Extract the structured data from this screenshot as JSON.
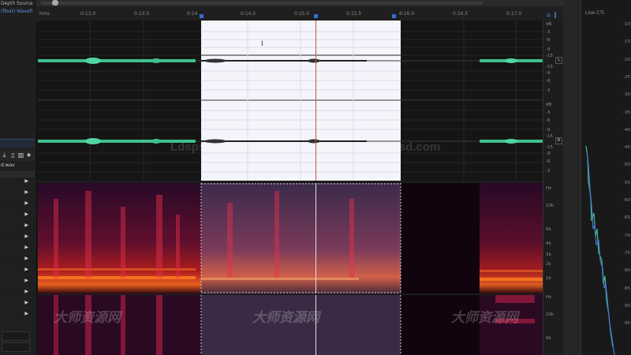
{
  "left_panel": {
    "columns": [
      {
        "header": "Depth",
        "value": "(float)"
      },
      {
        "header": "Source",
        "value": "Wavefi"
      }
    ],
    "file_name": "d.wav",
    "row_count": 13
  },
  "ruler": {
    "unit": "hms",
    "ticks": [
      "0:13.0",
      "0:13.5",
      "0:14",
      "0:14.5",
      "0:15.0",
      "0:15.5",
      "6:16.0",
      "0:16.5",
      "0:17.0"
    ]
  },
  "scale": {
    "channel_l": "L",
    "channel_r": "R",
    "level_labels_l": [
      "dB",
      "-3",
      "-6",
      "-9",
      "-15",
      "-15",
      "-9",
      "-6",
      "-3"
    ],
    "level_labels_r": [
      "dB",
      "-3",
      "-6",
      "-9",
      "-15",
      "-15",
      "-9",
      "-6",
      "-3"
    ],
    "freq_labels_1": [
      "Hz",
      "10k",
      "6k",
      "4k",
      "3k",
      "2k",
      "1k"
    ],
    "freq_labels_2": [
      "Hz",
      "10k",
      "6k"
    ]
  },
  "meter": {
    "title": "Live CTI",
    "labels": [
      "-10",
      "-15",
      "-20",
      "-25",
      "-30",
      "-35",
      "-40",
      "-45",
      "-50",
      "-55",
      "-60",
      "-65",
      "-70",
      "-75",
      "-80",
      "-85",
      "-90",
      "-95"
    ]
  },
  "watermarks": {
    "url_text": "Ldspsd.com",
    "cn_text": "大师资源网"
  },
  "colors": {
    "waveform": "#3ec08e",
    "selection": "#f4f4fb",
    "cursor": "#d04a4a",
    "accent": "#2d6fd6"
  }
}
